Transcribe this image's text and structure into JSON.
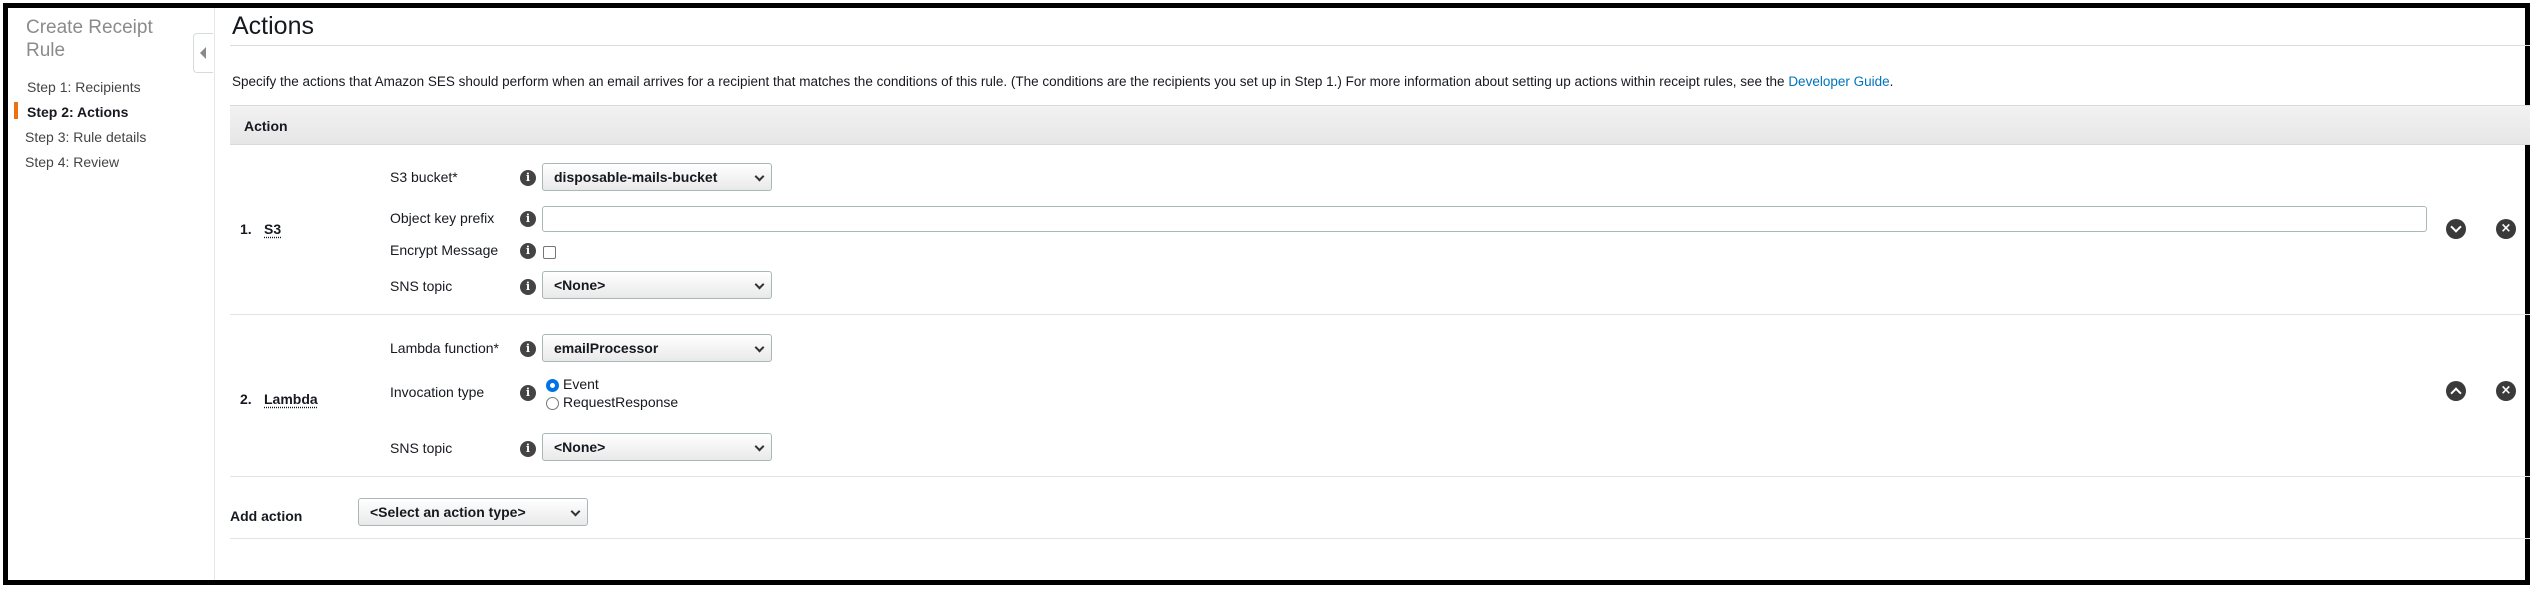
{
  "sidebar": {
    "title": "Create Receipt Rule",
    "steps": [
      {
        "label": "Step 1: Recipients"
      },
      {
        "label": "Step 2: Actions"
      },
      {
        "label": "Step 3: Rule details"
      },
      {
        "label": "Step 4: Review"
      }
    ],
    "active_step": 2
  },
  "main": {
    "title": "Actions",
    "description": "Specify the actions that Amazon SES should perform when an email arrives for a recipient that matches the conditions of this rule. (The conditions are the recipients you set up in Step 1.) For more information about setting up actions within receipt rules, see the ",
    "description_link": "Developer Guide",
    "description_end": ".",
    "table_header": "Action"
  },
  "actions": [
    {
      "number": "1.",
      "name": "S3",
      "fields": {
        "bucket_label": "S3 bucket*",
        "bucket_value": "disposable-mails-bucket",
        "prefix_label": "Object key prefix",
        "prefix_value": "",
        "encrypt_label": "Encrypt Message",
        "encrypt_checked": false,
        "sns_label": "SNS topic",
        "sns_value": "<None>"
      }
    },
    {
      "number": "2.",
      "name": "Lambda",
      "fields": {
        "function_label": "Lambda function*",
        "function_value": "emailProcessor",
        "invocation_label": "Invocation type",
        "invocation_options": [
          "Event",
          "RequestResponse"
        ],
        "invocation_selected": "Event",
        "sns_label": "SNS topic",
        "sns_value": "<None>"
      }
    }
  ],
  "add_action": {
    "label": "Add action",
    "select_value": "<Select an action type>"
  },
  "icons": {
    "info": "i",
    "remove": "×"
  },
  "colors": {
    "link": "#0073bb",
    "active_step_bar": "#ec7211",
    "radio_checked": "#0073e6"
  }
}
